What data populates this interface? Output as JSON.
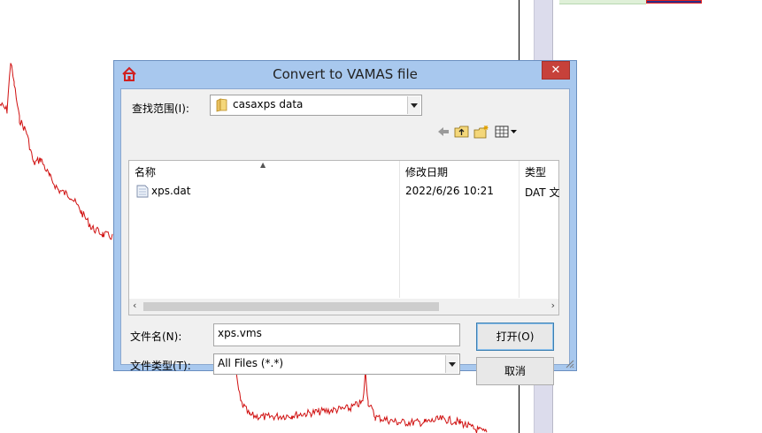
{
  "dialog": {
    "title": "Convert to VAMAS file",
    "close_glyph": "✕",
    "look_in_label": "查找范围(I):",
    "look_in_value": "casaxps data",
    "list": {
      "columns": [
        "名称",
        "修改日期",
        "类型"
      ],
      "rows": [
        {
          "name": "xps.dat",
          "modified": "2022/6/26 10:21",
          "type": "DAT 文"
        }
      ]
    },
    "filename_label": "文件名(N):",
    "filename_value": "xps.vms",
    "filetype_label": "文件类型(T):",
    "filetype_value": "All Files (*.*)",
    "open_label": "打开(O)",
    "cancel_label": "取消"
  },
  "icons": {
    "app": "house-icon",
    "folder": "folder-icon",
    "back": "back-arrow-icon",
    "up": "up-folder-icon",
    "new_folder": "new-folder-icon",
    "view_menu": "view-menu-icon",
    "file": "dat-file-icon"
  },
  "colors": {
    "dialog_frame": "#a8c8ee",
    "close_button": "#c7413a",
    "plot_line": "#d01010"
  }
}
